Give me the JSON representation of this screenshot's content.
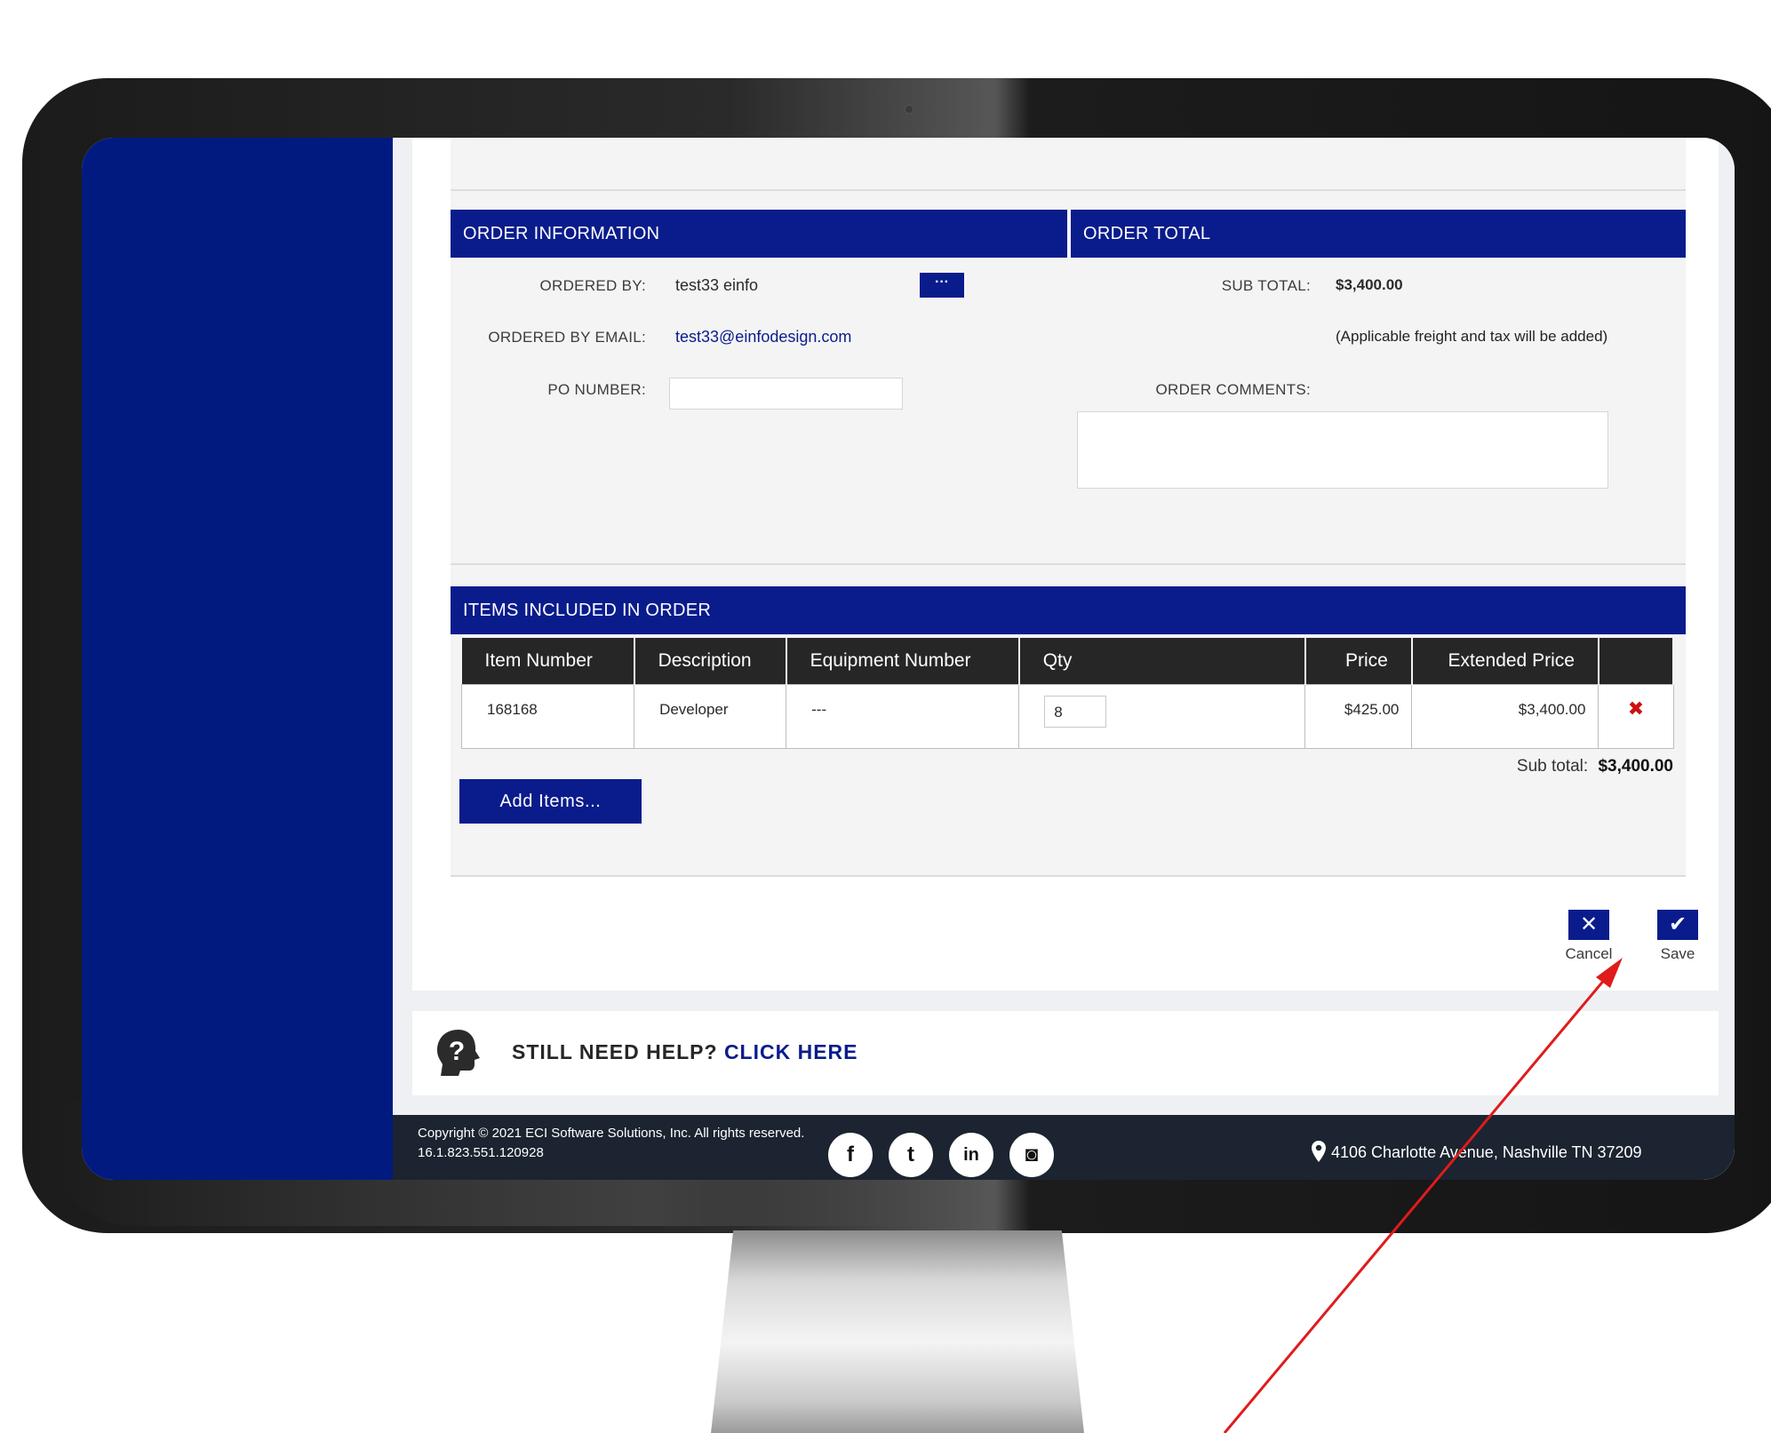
{
  "order_information": {
    "header": "ORDER INFORMATION",
    "ordered_by_label": "ORDERED BY:",
    "ordered_by_value": "test33 einfo",
    "lookup_button_label": "···",
    "ordered_by_email_label": "ORDERED BY EMAIL:",
    "ordered_by_email_value": "test33@einfodesign.com",
    "po_number_label": "PO NUMBER:",
    "po_number_value": ""
  },
  "order_total": {
    "header": "ORDER TOTAL",
    "sub_total_label": "SUB TOTAL:",
    "sub_total_value": "$3,400.00",
    "freight_note": "(Applicable freight and tax will be added)",
    "order_comments_label": "ORDER COMMENTS:",
    "order_comments_value": ""
  },
  "items": {
    "header": "ITEMS INCLUDED IN ORDER",
    "columns": [
      "Item Number",
      "Description",
      "Equipment Number",
      "Qty",
      "Price",
      "Extended Price"
    ],
    "rows": [
      {
        "item_number": "168168",
        "description": "Developer",
        "equipment_number": "---",
        "qty": "8",
        "price": "$425.00",
        "extended_price": "$3,400.00",
        "delete_icon": "delete-x-icon"
      }
    ],
    "sub_total_label": "Sub total:",
    "sub_total_value": "$3,400.00",
    "add_items_label": "Add Items..."
  },
  "actions": {
    "cancel_label": "Cancel",
    "save_label": "Save"
  },
  "help": {
    "prefix": "STILL NEED HELP?",
    "link": "CLICK HERE"
  },
  "footer": {
    "copyright": "Copyright © 2021 ECI Software Solutions, Inc. All rights reserved.",
    "version": "16.1.823.551.120928",
    "social": [
      {
        "name": "facebook-icon",
        "glyph": "f"
      },
      {
        "name": "twitter-icon",
        "glyph": "t"
      },
      {
        "name": "linkedin-icon",
        "glyph": "in"
      },
      {
        "name": "instagram-icon",
        "glyph": "◙"
      }
    ],
    "address": "4106 Charlotte Avenue, Nashville TN 37209"
  },
  "colors": {
    "brand_navy": "#0a1c8c",
    "sidebar_blue": "#001a80",
    "footer_dark": "#1b2430",
    "delete_red": "#cc1010",
    "annotation_red": "#e01b1b"
  }
}
